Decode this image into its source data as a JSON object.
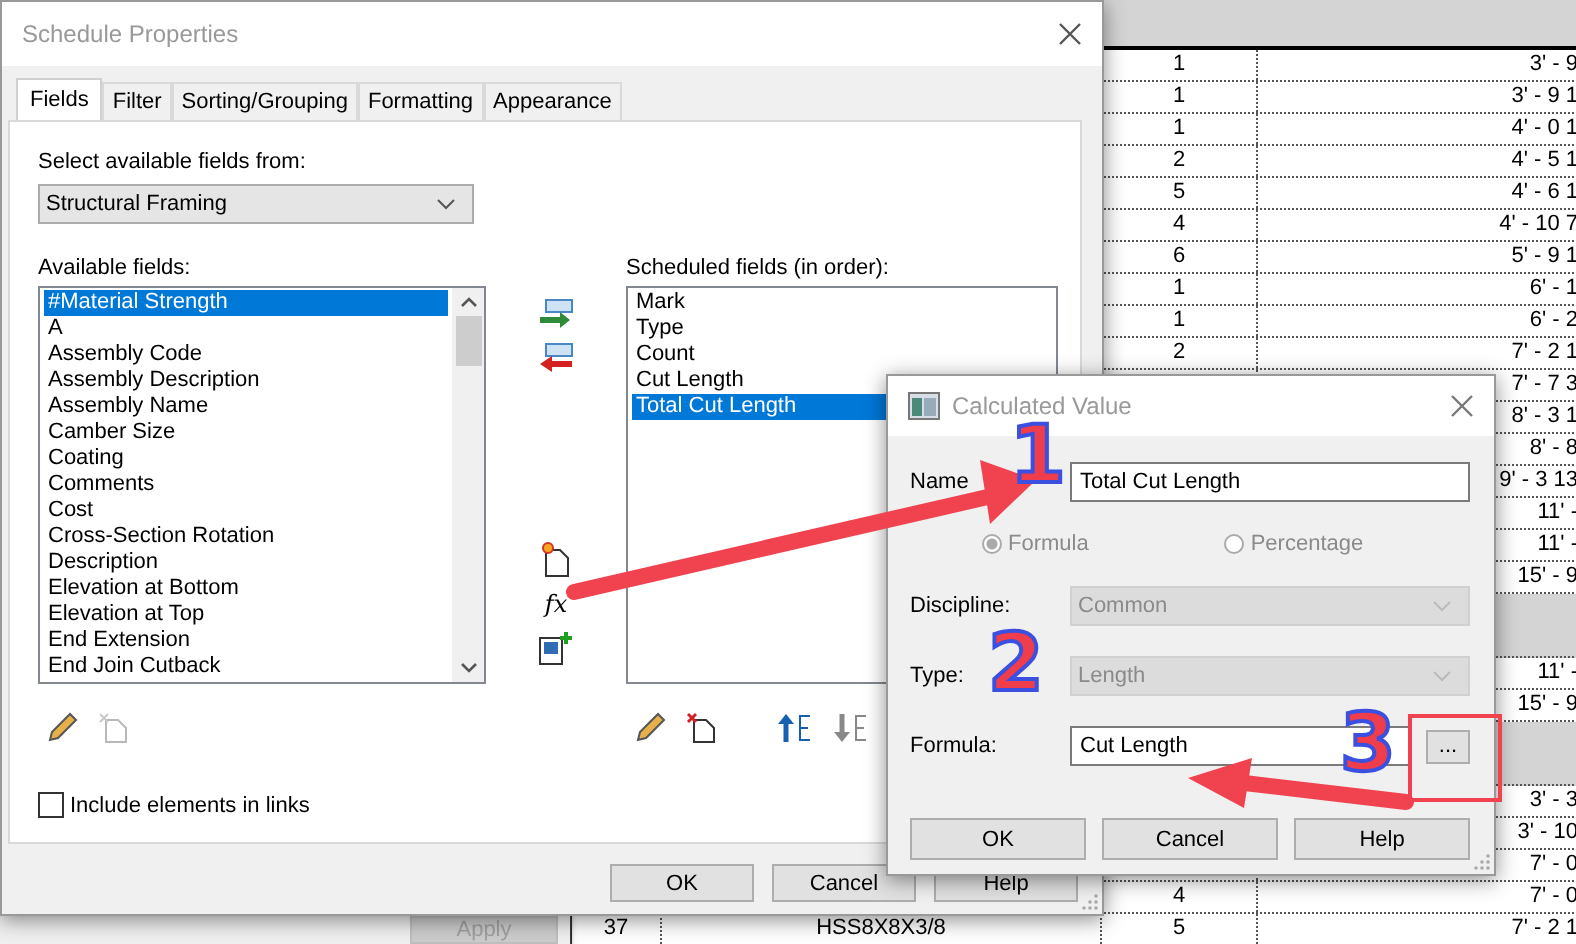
{
  "schedule_table": {
    "rows": [
      {
        "kind": "data",
        "count": "1",
        "length": "3' - 9"
      },
      {
        "kind": "data",
        "count": "1",
        "length": "3' - 9 1"
      },
      {
        "kind": "data",
        "count": "1",
        "length": "4' - 0 1"
      },
      {
        "kind": "data",
        "count": "2",
        "length": "4' - 5 1"
      },
      {
        "kind": "data",
        "count": "5",
        "length": "4' - 6 1"
      },
      {
        "kind": "data",
        "count": "4",
        "length": "4' - 10 7"
      },
      {
        "kind": "data",
        "count": "6",
        "length": "5' - 9 1"
      },
      {
        "kind": "data",
        "count": "1",
        "length": "6' - 1"
      },
      {
        "kind": "data",
        "count": "1",
        "length": "6' - 2"
      },
      {
        "kind": "data",
        "count": "2",
        "length": "7' - 2 1"
      },
      {
        "kind": "data",
        "length": "7' - 7 3"
      },
      {
        "kind": "data",
        "length": "8' - 3 1"
      },
      {
        "kind": "data",
        "length": "8' - 8"
      },
      {
        "kind": "data",
        "length": "9' - 3 13"
      },
      {
        "kind": "data",
        "length": "11' -"
      },
      {
        "kind": "data",
        "length": "11' -"
      },
      {
        "kind": "data",
        "length": "15' - 9"
      },
      {
        "kind": "group"
      },
      {
        "kind": "data",
        "length": "11' -"
      },
      {
        "kind": "data",
        "length": "15' - 9"
      },
      {
        "kind": "group"
      },
      {
        "kind": "data",
        "length": "3' - 3"
      },
      {
        "kind": "data",
        "length": "3' - 10"
      },
      {
        "kind": "data",
        "length": "7' - 0"
      },
      {
        "kind": "data",
        "count": "4",
        "length": "7' - 0"
      },
      {
        "kind": "data",
        "number": "37",
        "type": "HSS8X8X3/8",
        "count": "5",
        "length": "7' - 2 1"
      }
    ]
  },
  "apply_button": {
    "label": "Apply",
    "disabled": true
  },
  "schedule_properties": {
    "title": "Schedule Properties",
    "tabs": [
      {
        "label": "Fields",
        "selected": true
      },
      {
        "label": "Filter",
        "selected": false
      },
      {
        "label": "Sorting/Grouping",
        "selected": false
      },
      {
        "label": "Formatting",
        "selected": false
      },
      {
        "label": "Appearance",
        "selected": false
      }
    ],
    "source_label": "Select available fields from:",
    "source_value": "Structural Framing",
    "available_label": "Available fields:",
    "available_fields": [
      {
        "label": "#Material Strength",
        "selected": true
      },
      {
        "label": "A",
        "selected": false
      },
      {
        "label": "Assembly Code",
        "selected": false
      },
      {
        "label": "Assembly Description",
        "selected": false
      },
      {
        "label": "Assembly Name",
        "selected": false
      },
      {
        "label": "Camber Size",
        "selected": false
      },
      {
        "label": "Coating",
        "selected": false
      },
      {
        "label": "Comments",
        "selected": false
      },
      {
        "label": "Cost",
        "selected": false
      },
      {
        "label": "Cross-Section Rotation",
        "selected": false
      },
      {
        "label": "Description",
        "selected": false
      },
      {
        "label": "Elevation at Bottom",
        "selected": false
      },
      {
        "label": "Elevation at Top",
        "selected": false
      },
      {
        "label": "End Extension",
        "selected": false
      },
      {
        "label": "End Join Cutback",
        "selected": false
      }
    ],
    "formula_icon": "fx",
    "scheduled_label": "Scheduled fields (in order):",
    "scheduled_fields": [
      {
        "label": "Mark",
        "selected": false
      },
      {
        "label": "Type",
        "selected": false
      },
      {
        "label": "Count",
        "selected": false
      },
      {
        "label": "Cut Length",
        "selected": false
      },
      {
        "label": "Total Cut Length",
        "selected": true
      }
    ],
    "include_links": {
      "label": "Include elements in links",
      "checked": false
    },
    "buttons": [
      {
        "label": "OK"
      },
      {
        "label": "Cancel"
      },
      {
        "label": "Help"
      }
    ]
  },
  "calculated_value": {
    "title": "Calculated Value",
    "name_label": "Name",
    "name_value": "Total Cut Length",
    "modes": [
      {
        "label": "Formula",
        "selected": true,
        "disabled": true
      },
      {
        "label": "Percentage",
        "selected": false,
        "disabled": true
      }
    ],
    "discipline": {
      "label": "Discipline:",
      "value": "Common",
      "disabled": true
    },
    "type": {
      "label": "Type:",
      "value": "Length",
      "disabled": true
    },
    "formula": {
      "label": "Formula:",
      "value": "Cut Length"
    },
    "browse_button": "...",
    "buttons": [
      {
        "label": "OK"
      },
      {
        "label": "Cancel"
      },
      {
        "label": "Help"
      }
    ]
  },
  "annotations": {
    "steps": [
      {
        "label": "1"
      },
      {
        "label": "2"
      },
      {
        "label": "3"
      }
    ]
  }
}
